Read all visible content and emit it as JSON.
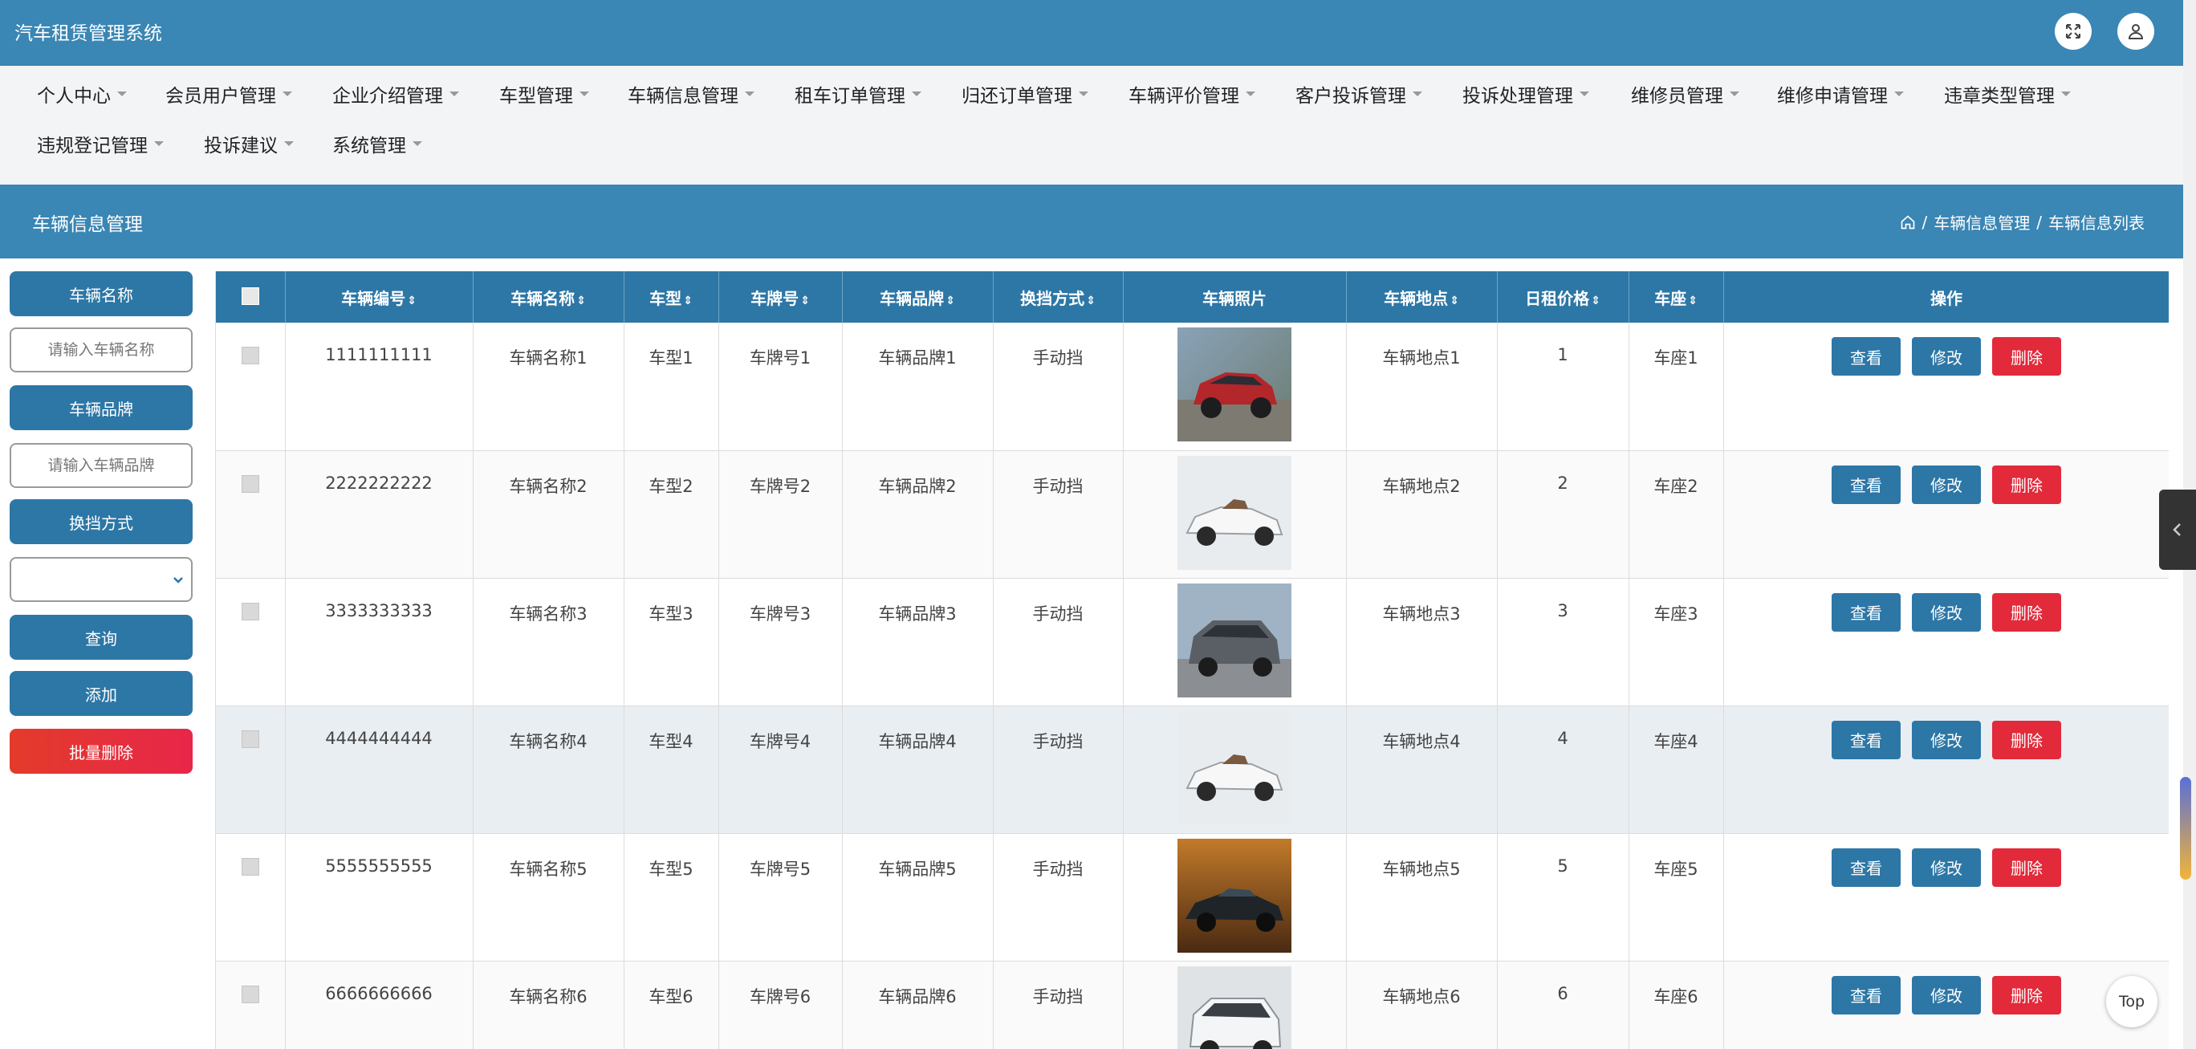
{
  "app": {
    "title": "汽车租赁管理系统"
  },
  "nav": {
    "items": [
      "个人中心",
      "会员用户管理",
      "企业介绍管理",
      "车型管理",
      "车辆信息管理",
      "租车订单管理",
      "归还订单管理",
      "车辆评价管理",
      "客户投诉管理",
      "投诉处理管理",
      "维修员管理",
      "维修申请管理",
      "违章类型管理",
      "违规登记管理",
      "投诉建议",
      "系统管理"
    ]
  },
  "titlebar": {
    "title": "车辆信息管理",
    "breadcrumb": [
      "车辆信息管理",
      "车辆信息列表"
    ]
  },
  "sidebar": {
    "name_label": "车辆名称",
    "name_placeholder": "请输入车辆名称",
    "brand_label": "车辆品牌",
    "brand_placeholder": "请输入车辆品牌",
    "gear_label": "换挡方式",
    "query": "查询",
    "add": "添加",
    "batch_delete": "批量删除"
  },
  "table": {
    "headers": [
      "车辆编号",
      "车辆名称",
      "车型",
      "车牌号",
      "车辆品牌",
      "换挡方式",
      "车辆照片",
      "车辆地点",
      "日租价格",
      "车座",
      "操作"
    ],
    "sortable": [
      true,
      true,
      true,
      true,
      true,
      true,
      false,
      true,
      true,
      true,
      false
    ],
    "actions": {
      "view": "查看",
      "edit": "修改",
      "delete": "删除"
    },
    "rows": [
      {
        "id": "1111111111",
        "name": "车辆名称1",
        "model": "车型1",
        "plate": "车牌号1",
        "brand": "车辆品牌1",
        "gear": "手动挡",
        "photo": "red-suv",
        "location": "车辆地点1",
        "price": "1",
        "seat": "车座1"
      },
      {
        "id": "2222222222",
        "name": "车辆名称2",
        "model": "车型2",
        "plate": "车牌号2",
        "brand": "车辆品牌2",
        "gear": "手动挡",
        "photo": "white-roadster",
        "location": "车辆地点2",
        "price": "2",
        "seat": "车座2"
      },
      {
        "id": "3333333333",
        "name": "车辆名称3",
        "model": "车型3",
        "plate": "车牌号3",
        "brand": "车辆品牌3",
        "gear": "手动挡",
        "photo": "grey-minivan",
        "location": "车辆地点3",
        "price": "3",
        "seat": "车座3"
      },
      {
        "id": "4444444444",
        "name": "车辆名称4",
        "model": "车型4",
        "plate": "车牌号4",
        "brand": "车辆品牌4",
        "gear": "手动挡",
        "photo": "white-roadster",
        "location": "车辆地点4",
        "price": "4",
        "seat": "车座4"
      },
      {
        "id": "5555555555",
        "name": "车辆名称5",
        "model": "车型5",
        "plate": "车牌号5",
        "brand": "车辆品牌5",
        "gear": "手动挡",
        "photo": "dark-sports",
        "location": "车辆地点5",
        "price": "5",
        "seat": "车座5"
      },
      {
        "id": "6666666666",
        "name": "车辆名称6",
        "model": "车型6",
        "plate": "车牌号6",
        "brand": "车辆品牌6",
        "gear": "手动挡",
        "photo": "white-van",
        "location": "车辆地点6",
        "price": "6",
        "seat": "车座6"
      }
    ]
  },
  "float": {
    "top": "Top"
  },
  "colors": {
    "primary": "#3a86b4",
    "button": "#2d77a6",
    "danger": "#e22a3a"
  },
  "icons": {
    "fullscreen": "expand-icon",
    "user": "user-icon",
    "home": "home-icon",
    "collapse": "chevron-left-icon"
  }
}
